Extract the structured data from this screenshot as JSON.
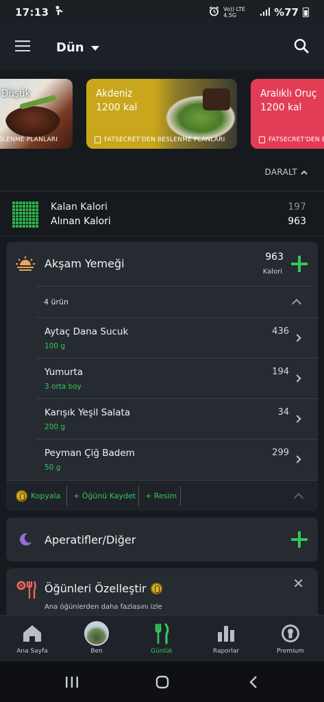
{
  "status_bar": {
    "time": "17:13",
    "network": "Vo)) LTE 4.5G",
    "battery": "%77"
  },
  "app_bar": {
    "title": "Dün"
  },
  "plans": [
    {
      "name": "Düşük",
      "kcal": "",
      "footer": "ESLENME PLANLARI",
      "color": "#8b2e22"
    },
    {
      "name": "Akdeniz",
      "kcal": "1200 kal",
      "footer": "FATSECRET'DEN BESLENME PLANLARI",
      "color": "#c9a61b"
    },
    {
      "name": "Aralıklı Oruç",
      "kcal": "1200 kal",
      "footer": "FATSECRET'DEN BE",
      "color": "#e23d55"
    }
  ],
  "collapse_label": "DARALT",
  "summary": {
    "remaining_label": "Kalan Kalori",
    "remaining_value": "197",
    "consumed_label": "Alınan Kalori",
    "consumed_value": "963"
  },
  "dinner": {
    "name": "Akşam Yemeği",
    "kcal": "963",
    "kcal_label": "Kalori",
    "item_count": "4 ürün",
    "items": [
      {
        "name": "Aytaç Dana Sucuk",
        "qty": "100 g",
        "kcal": "436"
      },
      {
        "name": "Yumurta",
        "qty": "3 orta boy",
        "kcal": "194"
      },
      {
        "name": "Karışık Yeşil Salata",
        "qty": "200 g",
        "kcal": "34"
      },
      {
        "name": "Peyman Çiğ Badem",
        "qty": "50 g",
        "kcal": "299"
      }
    ],
    "actions": {
      "copy": "Kopyala",
      "save": "+ Öğünü Kaydet",
      "photo": "+ Resim"
    }
  },
  "snacks": {
    "name": "Aperatifler/Diğer"
  },
  "customize": {
    "title": "Öğünleri Özelleştir",
    "subtitle": "Ana öğünlerden daha fazlasını izle"
  },
  "tabs": [
    {
      "label": "Ana Sayfa"
    },
    {
      "label": "Ben"
    },
    {
      "label": "Günlük"
    },
    {
      "label": "Raporlar"
    },
    {
      "label": "Premium"
    }
  ],
  "colors": {
    "accent": "#34c759",
    "background": "#161a1f",
    "card": "#262b31"
  }
}
